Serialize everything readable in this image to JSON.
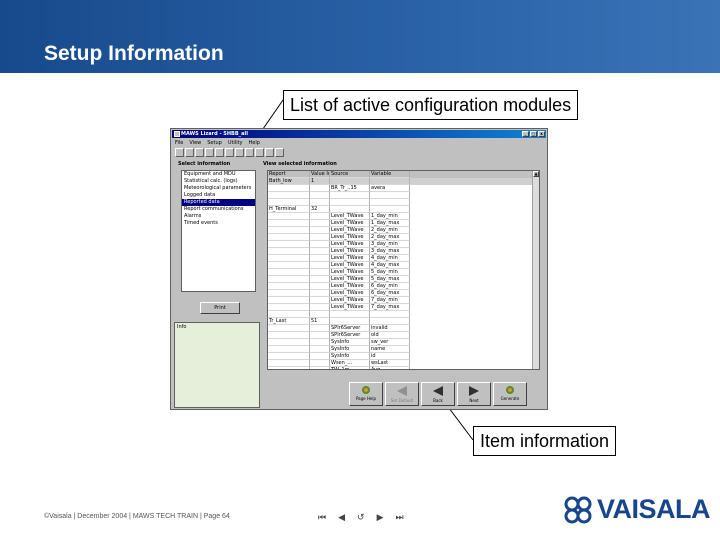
{
  "slide": {
    "title": "Setup Information",
    "callout_top": "List of active configuration modules",
    "callout_bottom": "Item information",
    "footer": "©Vaisala | December 2004 | MAWS TECH TRAIN | Page 64",
    "logo_text": "VAISALA",
    "colors": {
      "header": "#1f5599",
      "logo": "#17468c"
    }
  },
  "app": {
    "title": "MAWS Lizard - SHBB_all",
    "window_buttons": [
      "_",
      "□",
      "x"
    ],
    "menu": [
      "File",
      "View",
      "Setup",
      "Utility",
      "Help"
    ],
    "toolbar_icons": [
      "new-icon",
      "open-icon",
      "save-icon",
      "cut-icon",
      "copy-icon",
      "paste-icon",
      "print-icon",
      "setup-icon",
      "terminal-icon",
      "help-icon",
      "info-icon"
    ],
    "left_panel": {
      "label": "Select information",
      "items": [
        {
          "label": "Equipment and MDU"
        },
        {
          "label": "Statistical calc. (logs)"
        },
        {
          "label": "Meteorological parameters"
        },
        {
          "label": "Logged data"
        },
        {
          "label": "Reported data",
          "selected": true
        },
        {
          "label": "Report communications"
        },
        {
          "label": "Alarms"
        },
        {
          "label": "Timed events"
        }
      ],
      "print_label": "Print"
    },
    "info_panel": {
      "label": "Info"
    },
    "right_panel": {
      "label": "View selected information",
      "columns": [
        "Report",
        "Value Id",
        "Source",
        "Variable"
      ],
      "rows": [
        [
          "Bath_low",
          "1",
          "",
          ""
        ],
        [
          "",
          "",
          "BR_Tr_..15",
          "avera"
        ],
        [
          "",
          "",
          "",
          ""
        ],
        [
          "",
          "",
          "",
          ""
        ],
        [
          "H_Terminal",
          "32",
          "",
          ""
        ],
        [
          "",
          "",
          "Level_TWave",
          "1_day_min"
        ],
        [
          "",
          "",
          "Level_TWave",
          "1_day_max"
        ],
        [
          "",
          "",
          "Level_TWave",
          "2_day_min"
        ],
        [
          "",
          "",
          "Level_TWave",
          "2_day_max"
        ],
        [
          "",
          "",
          "Level_TWave",
          "3_day_min"
        ],
        [
          "",
          "",
          "Level_TWave",
          "3_day_max"
        ],
        [
          "",
          "",
          "Level_TWave",
          "4_day_min"
        ],
        [
          "",
          "",
          "Level_TWave",
          "4_day_max"
        ],
        [
          "",
          "",
          "Level_TWave",
          "5_day_min"
        ],
        [
          "",
          "",
          "Level_TWave",
          "5_day_max"
        ],
        [
          "",
          "",
          "Level_TWave",
          "6_day_min"
        ],
        [
          "",
          "",
          "Level_TWave",
          "6_day_max"
        ],
        [
          "",
          "",
          "Level_TWave",
          "7_day_min"
        ],
        [
          "",
          "",
          "Level_TWave",
          "7_day_max"
        ],
        [
          "",
          "",
          "",
          ""
        ],
        [
          "Tr_Last",
          "51",
          "",
          ""
        ],
        [
          "",
          "",
          "SPIr6Server",
          "invalid"
        ],
        [
          "",
          "",
          "SPIr6Server",
          "old"
        ],
        [
          "",
          "",
          "SysInfo",
          "sw_ver"
        ],
        [
          "",
          "",
          "SysInfo",
          "name"
        ],
        [
          "",
          "",
          "SysInfo",
          "id"
        ],
        [
          "",
          "",
          "Wsen_...",
          "wsLast"
        ],
        [
          "",
          "",
          "TW_1m",
          "Avg"
        ]
      ]
    },
    "nav_buttons": [
      {
        "label": "Page Help",
        "icon": "gear-icon",
        "enabled": true
      },
      {
        "label": "Set Default",
        "icon": "arrow-left-icon",
        "enabled": false
      },
      {
        "label": "Back",
        "icon": "arrow-left-icon",
        "enabled": true
      },
      {
        "label": "Next",
        "icon": "arrow-right-icon",
        "enabled": true
      },
      {
        "label": "Generate",
        "icon": "gear-icon",
        "enabled": true
      }
    ]
  }
}
